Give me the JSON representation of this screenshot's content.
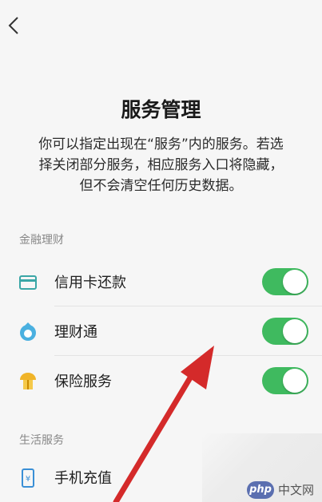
{
  "header": {
    "title": "服务管理",
    "description": [
      "你可以指定出现在“服务”内的服务。若选",
      "择关闭部分服务，相应服务入口将隐藏，",
      "但不会清空任何历史数据。"
    ]
  },
  "sections": [
    {
      "label": "金融理财",
      "items": [
        {
          "label": "信用卡还款",
          "icon": "credit-card-icon",
          "enabled": true
        },
        {
          "label": "理财通",
          "icon": "wealth-icon",
          "enabled": true
        },
        {
          "label": "保险服务",
          "icon": "insurance-icon",
          "enabled": true
        }
      ]
    },
    {
      "label": "生活服务",
      "items": [
        {
          "label": "手机充值",
          "icon": "phone-recharge-icon"
        }
      ]
    }
  ],
  "watermark": {
    "badge": "php",
    "text": "中文网"
  },
  "colors": {
    "toggle_on": "#3fba5f",
    "icon_teal": "#3aa6a6",
    "arrow_red": "#d42a2a"
  }
}
